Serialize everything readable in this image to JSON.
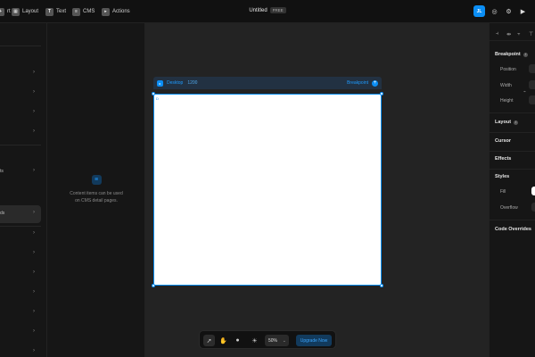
{
  "topbar": {
    "left_items": [
      {
        "label": "rt",
        "icon": "insert-icon"
      },
      {
        "label": "Layout",
        "icon": "layout-icon"
      },
      {
        "label": "Text",
        "icon": "text-icon"
      },
      {
        "label": "CMS",
        "icon": "cms-icon"
      },
      {
        "label": "Actions",
        "icon": "actions-icon"
      }
    ],
    "title": "Untitled",
    "title_badge": "FREE",
    "avatar_initials": "JL"
  },
  "left_panel": {
    "items": [
      {
        "label": ""
      },
      {
        "label": ""
      },
      {
        "label": ""
      },
      {
        "label": ""
      },
      {
        "label": "ts"
      },
      {
        "label": "ds"
      },
      {
        "label": ""
      },
      {
        "label": ""
      },
      {
        "label": ""
      },
      {
        "label": ""
      },
      {
        "label": ""
      },
      {
        "label": ""
      },
      {
        "label": ""
      },
      {
        "label": ""
      }
    ]
  },
  "cms_panel": {
    "empty_line1": "Content items can be used",
    "empty_line2": "on CMS detail pages."
  },
  "canvas": {
    "frame_name": "Desktop",
    "frame_width": "1200",
    "breakpoint_label": "Breakpoint",
    "frame_mark": "D"
  },
  "bottom_toolbar": {
    "zoom": "50%",
    "upgrade_label": "Upgrade Now"
  },
  "right_panel": {
    "breakpoint": {
      "heading": "Breakpoint",
      "position_label": "Position",
      "width_label": "Width",
      "height_label": "Height"
    },
    "layout_heading": "Layout",
    "cursor_heading": "Cursor",
    "effects_heading": "Effects",
    "styles": {
      "heading": "Styles",
      "fill_label": "Fill",
      "overflow_label": "Overflow"
    },
    "code_overrides_heading": "Code Overrides"
  },
  "colors": {
    "accent": "#0b8ef5",
    "background": "#171717",
    "canvas": "#232323"
  }
}
